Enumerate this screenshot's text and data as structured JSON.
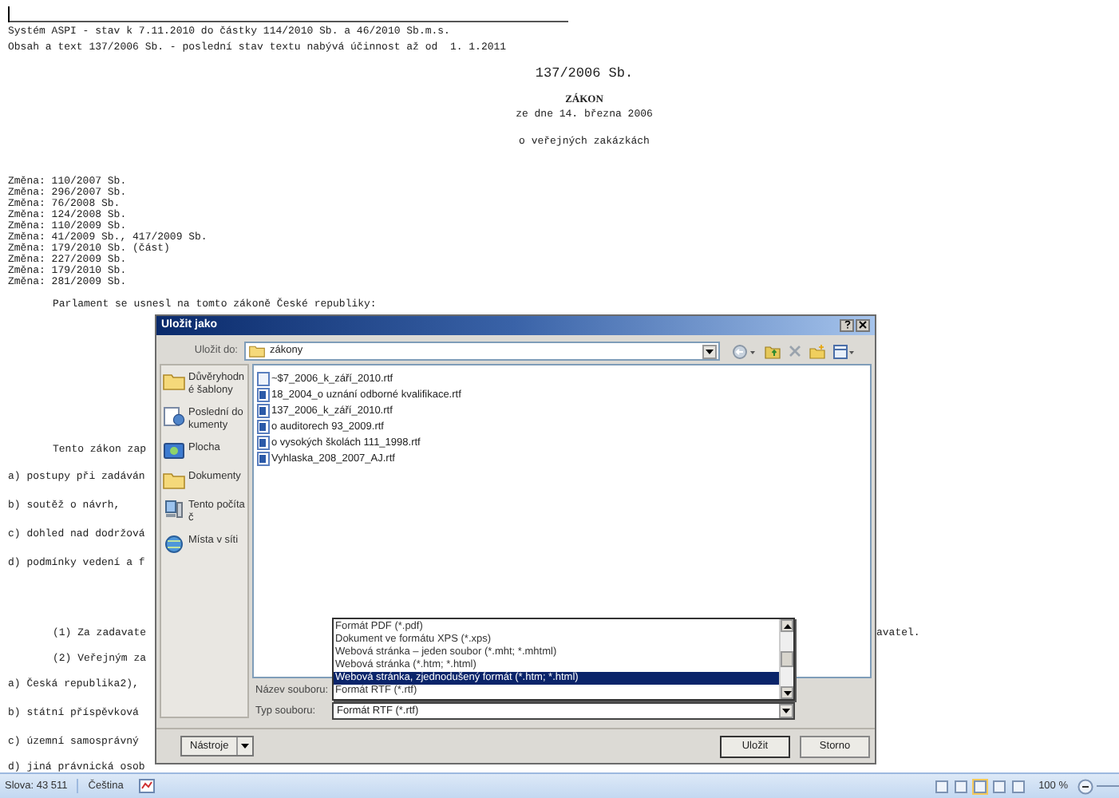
{
  "document": {
    "header_lines": [
      "Systém ASPI - stav k 7.11.2010 do částky 114/2010 Sb. a 46/2010 Sb.m.s.",
      "Obsah a text 137/2006 Sb. - poslední stav textu nabývá účinnost až od  1. 1.2011"
    ],
    "number": "137/2006 Sb.",
    "heading": "ZÁKON",
    "date": "ze dne 14. března 2006",
    "subject": "o veřejných zakázkách",
    "amendments": [
      "Změna: 110/2007 Sb.",
      "Změna: 296/2007 Sb.",
      "Změna: 76/2008 Sb.",
      "Změna: 124/2008 Sb.",
      "Změna: 110/2009 Sb.",
      "Změna: 41/2009 Sb., 417/2009 Sb.",
      "Změna: 179/2010 Sb. (část)",
      "Změna: 227/2009 Sb.",
      "Změna: 179/2010 Sb.",
      "Změna: 281/2009 Sb."
    ],
    "preamble": "Parlament se usnesl na tomto zákoně České republiky:",
    "blocks": [
      {
        "kind": "indent",
        "text": "Tento zákon zap"
      },
      {
        "kind": "item",
        "text": "a) postupy při zadáván"
      },
      {
        "kind": "item",
        "text": "b) soutěž o návrh,"
      },
      {
        "kind": "item",
        "text": "c) dohled nad dodržová"
      },
      {
        "kind": "item",
        "text": "d) podmínky vedení a f"
      },
      {
        "kind": "indent",
        "text": "(1) Za zadavate",
        "tail": "avatel."
      },
      {
        "kind": "indent",
        "text": "(2) Veřejným za"
      },
      {
        "kind": "item",
        "text": "a) Česká republika2),"
      },
      {
        "kind": "item",
        "text": "b) státní příspěvková"
      },
      {
        "kind": "item",
        "text": "c) územní samosprávný"
      },
      {
        "kind": "item",
        "text": "d) jiná právnická osob"
      }
    ]
  },
  "dialog": {
    "title": "Uložit jako",
    "save_in_label": "Uložit do:",
    "save_in_value": "zákony",
    "places": [
      {
        "kind": "folder",
        "label": "Důvěryhodné šablony"
      },
      {
        "kind": "recent",
        "label": "Poslední dokumenty"
      },
      {
        "kind": "desktop",
        "label": "Plocha"
      },
      {
        "kind": "documents",
        "label": "Dokumenty"
      },
      {
        "kind": "computer",
        "label": "Tento počítač"
      },
      {
        "kind": "network",
        "label": "Místa v síti"
      }
    ],
    "files": [
      {
        "kind": "temp",
        "name": "~$7_2006_k_září_2010.rtf"
      },
      {
        "kind": "doc",
        "name": "18_2004_o uznání odborné kvalifikace.rtf"
      },
      {
        "kind": "doc",
        "name": "137_2006_k_září_2010.rtf"
      },
      {
        "kind": "doc",
        "name": "o auditorech 93_2009.rtf"
      },
      {
        "kind": "doc",
        "name": "o vysokých školách 111_1998.rtf"
      },
      {
        "kind": "doc",
        "name": "Vyhlaska_208_2007_AJ.rtf"
      }
    ],
    "filename_label": "Název souboru:",
    "type_label": "Typ souboru:",
    "type_value": "Formát RTF (*.rtf)",
    "type_options": [
      {
        "label": "Formát PDF (*.pdf)",
        "selected": false
      },
      {
        "label": "Dokument ve formátu XPS (*.xps)",
        "selected": false
      },
      {
        "label": "Webová stránka – jeden soubor (*.mht; *.mhtml)",
        "selected": false
      },
      {
        "label": "Webová stránka (*.htm; *.html)",
        "selected": false
      },
      {
        "label": "Webová stránka, zjednodušený formát (*.htm; *.html)",
        "selected": true
      },
      {
        "label": "Formát RTF (*.rtf)",
        "selected": false
      }
    ],
    "tools_button": "Nástroje",
    "save_button": "Uložit",
    "cancel_button": "Storno"
  },
  "status_bar": {
    "words": "Slova: 43 511",
    "language": "Čeština",
    "zoom": "100 %"
  }
}
